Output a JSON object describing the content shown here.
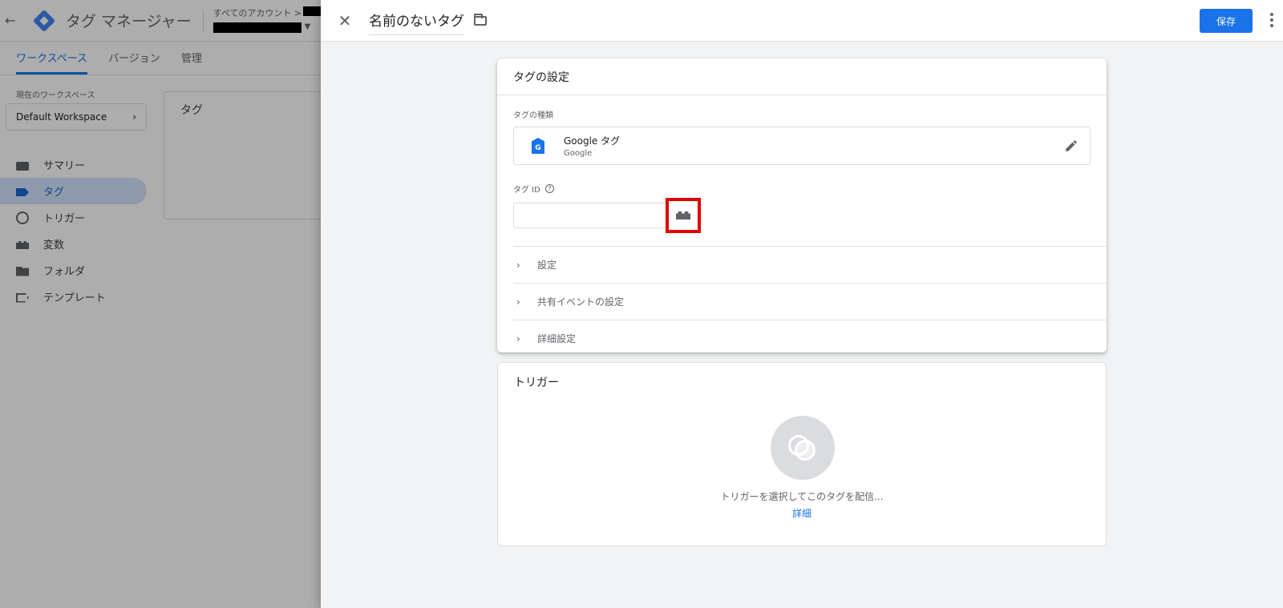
{
  "app": {
    "title": "タグ マネージャー",
    "breadcrumb": "すべてのアカウント >",
    "tabs": [
      {
        "label": "ワークスペース",
        "active": true
      },
      {
        "label": "バージョン",
        "active": false
      },
      {
        "label": "管理",
        "active": false
      }
    ],
    "workspace_label": "現在のワークスペース",
    "workspace_name": "Default Workspace",
    "nav": [
      {
        "label": "サマリー",
        "icon": "summary-icon",
        "active": false
      },
      {
        "label": "タグ",
        "icon": "tag-icon",
        "active": true
      },
      {
        "label": "トリガー",
        "icon": "trigger-icon",
        "active": false
      },
      {
        "label": "変数",
        "icon": "variable-icon",
        "active": false
      },
      {
        "label": "フォルダ",
        "icon": "folder-icon",
        "active": false
      },
      {
        "label": "テンプレート",
        "icon": "template-icon",
        "active": false
      }
    ],
    "bg_card_title": "タグ"
  },
  "editor": {
    "tag_name": "名前のないタグ",
    "save_label": "保存",
    "config": {
      "title": "タグの設定",
      "type_label": "タグの種類",
      "type_name": "Google タグ",
      "type_vendor": "Google",
      "tag_id_label": "タグ ID",
      "tag_id_value": "",
      "sections": [
        "設定",
        "共有イベントの設定",
        "詳細設定"
      ]
    },
    "trigger": {
      "title": "トリガー",
      "hint": "トリガーを選択してこのタグを配信...",
      "link": "詳細"
    }
  },
  "colors": {
    "accent": "#1a73e8",
    "highlight": "#e00000"
  }
}
